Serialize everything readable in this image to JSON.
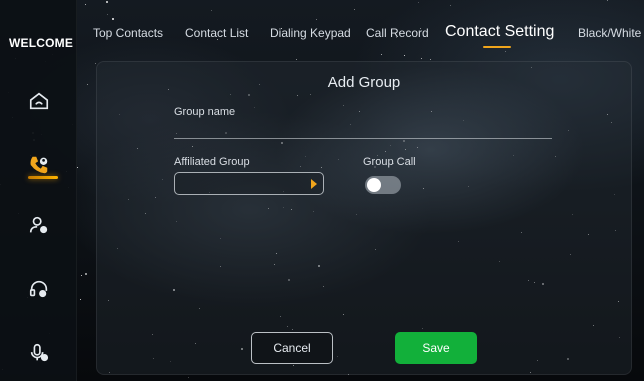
{
  "sidebar": {
    "title": "WELCOME",
    "items": [
      {
        "icon": "home-phone-icon",
        "active": false
      },
      {
        "icon": "phone-contact-icon",
        "active": true
      },
      {
        "icon": "contact-settings-icon",
        "active": false
      },
      {
        "icon": "headset-icon",
        "active": false
      },
      {
        "icon": "microphone-icon",
        "active": false
      }
    ],
    "accent_color": "#f0a51c"
  },
  "tabs": [
    {
      "label": "Top Contacts",
      "active": false
    },
    {
      "label": "Contact List",
      "active": false
    },
    {
      "label": "Dialing Keypad",
      "active": false
    },
    {
      "label": "Call Record",
      "active": false
    },
    {
      "label": "Contact Setting",
      "active": true
    },
    {
      "label": "Black/White",
      "active": false
    }
  ],
  "dialog": {
    "title": "Add Group",
    "group_name_label": "Group name",
    "group_name_value": "",
    "affiliated_group_label": "Affiliated Group",
    "affiliated_group_value": "",
    "group_call_label": "Group Call",
    "group_call_enabled": false,
    "cancel_label": "Cancel",
    "save_label": "Save",
    "save_color": "#12b03a"
  }
}
